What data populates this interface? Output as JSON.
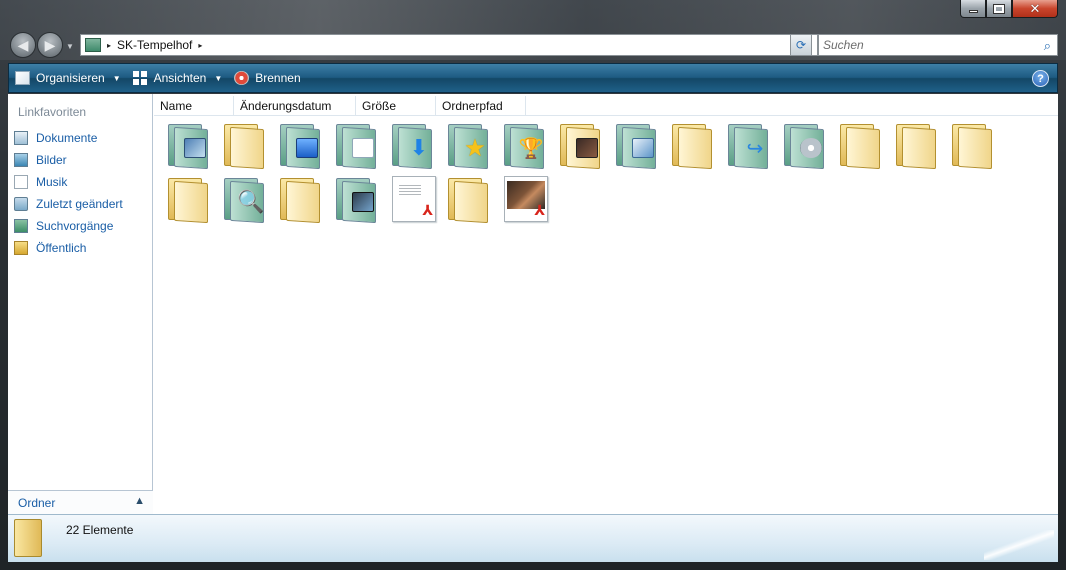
{
  "window": {
    "caption_buttons": {
      "minimize": "minimize",
      "maximize": "maximize",
      "close": "✕"
    }
  },
  "navigation": {
    "back_glyph": "◀",
    "forward_glyph": "▶",
    "address": {
      "path": [
        "SK-Tempelhof"
      ],
      "separator": "▸"
    },
    "refresh_glyph": "⟳",
    "search": {
      "placeholder": "Suchen",
      "value": ""
    }
  },
  "toolbar": {
    "organize_label": "Organisieren",
    "views_label": "Ansichten",
    "burn_label": "Brennen",
    "help_label": "?"
  },
  "sidebar": {
    "heading": "Linkfavoriten",
    "items": [
      {
        "label": "Dokumente",
        "icon": "documents-icon"
      },
      {
        "label": "Bilder",
        "icon": "pictures-icon"
      },
      {
        "label": "Musik",
        "icon": "music-icon"
      },
      {
        "label": "Zuletzt geändert",
        "icon": "recent-icon"
      },
      {
        "label": "Suchvorgänge",
        "icon": "searches-icon"
      },
      {
        "label": "Öffentlich",
        "icon": "public-folder-icon"
      }
    ],
    "folders_label": "Ordner",
    "folders_chevron": "▲"
  },
  "file_list": {
    "columns": [
      "Name",
      "Änderungsdatum",
      "Größe",
      "Ordnerpfad"
    ],
    "items": [
      {
        "icon": "pictures-folder-icon"
      },
      {
        "icon": "folder-icon"
      },
      {
        "icon": "desktop-folder-icon"
      },
      {
        "icon": "documents-folder-icon"
      },
      {
        "icon": "downloads-folder-icon"
      },
      {
        "icon": "favorites-folder-icon"
      },
      {
        "icon": "games-folder-icon"
      },
      {
        "icon": "photo-folder-icon"
      },
      {
        "icon": "contacts-folder-icon"
      },
      {
        "icon": "folder-icon"
      },
      {
        "icon": "links-folder-icon"
      },
      {
        "icon": "music-folder-icon"
      },
      {
        "icon": "folder-icon"
      },
      {
        "icon": "folder-icon"
      },
      {
        "icon": "folder-icon"
      },
      {
        "icon": "folder-icon"
      },
      {
        "icon": "searches-folder-icon"
      },
      {
        "icon": "folder-icon"
      },
      {
        "icon": "videos-folder-icon"
      },
      {
        "icon": "pdf-document-icon"
      },
      {
        "icon": "folder-icon"
      },
      {
        "icon": "pdf-photo-document-icon"
      }
    ]
  },
  "status": {
    "count_text": "22 Elemente"
  },
  "colors": {
    "command_bar": "#1d5a82",
    "link_text": "#1a5ea6",
    "heading_text": "#7d8a97"
  }
}
